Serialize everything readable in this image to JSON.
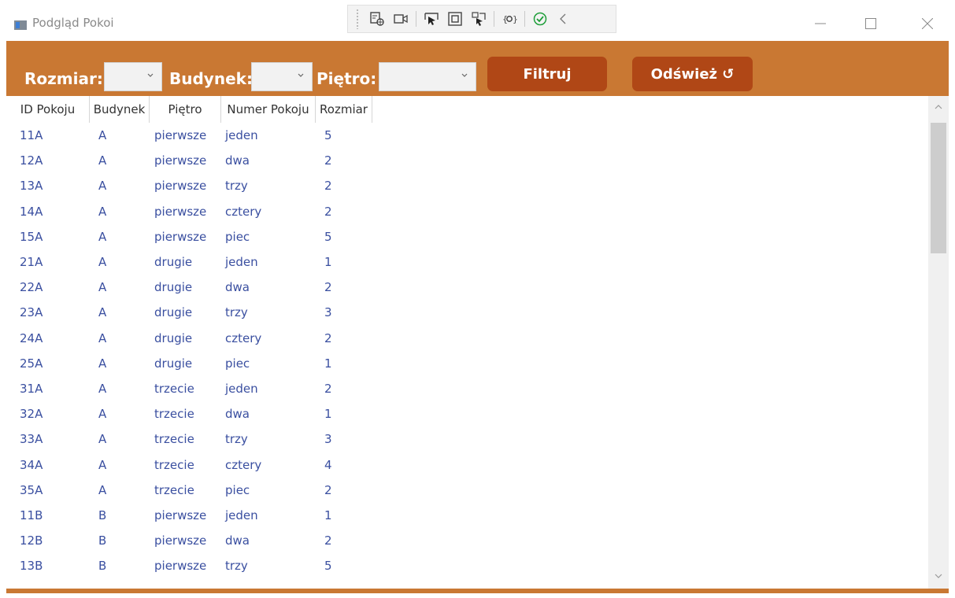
{
  "window": {
    "title": "Podgląd Pokoi",
    "controls": [
      "minimize",
      "maximize",
      "close"
    ]
  },
  "debug_toolbar": {
    "icons": [
      "live-visual-tree-icon",
      "record-icon",
      "select-element-icon",
      "display-layout-adorners-icon",
      "track-focused-element-icon",
      "binding-failures-icon",
      "hot-reload-ok-icon",
      "collapse-toolbar-icon"
    ]
  },
  "filters": {
    "rozmiar_label": "Rozmiar:",
    "rozmiar_value": "",
    "budynek_label": "Budynek:",
    "budynek_value": "",
    "pietro_label": "Piętro:",
    "pietro_value": "",
    "filter_button": "Filtruj",
    "refresh_button": "Odśwież ↺"
  },
  "grid": {
    "columns": [
      "ID Pokoju",
      "Budynek",
      "Piętro",
      "Numer Pokoju",
      "Rozmiar"
    ],
    "rows": [
      [
        "11A",
        "A",
        "pierwsze",
        "jeden",
        "5"
      ],
      [
        "12A",
        "A",
        "pierwsze",
        "dwa",
        "2"
      ],
      [
        "13A",
        "A",
        "pierwsze",
        "trzy",
        "2"
      ],
      [
        "14A",
        "A",
        "pierwsze",
        "cztery",
        "2"
      ],
      [
        "15A",
        "A",
        "pierwsze",
        "piec",
        "5"
      ],
      [
        "21A",
        "A",
        "drugie",
        "jeden",
        "1"
      ],
      [
        "22A",
        "A",
        "drugie",
        "dwa",
        "2"
      ],
      [
        "23A",
        "A",
        "drugie",
        "trzy",
        "3"
      ],
      [
        "24A",
        "A",
        "drugie",
        "cztery",
        "2"
      ],
      [
        "25A",
        "A",
        "drugie",
        "piec",
        "1"
      ],
      [
        "31A",
        "A",
        "trzecie",
        "jeden",
        "2"
      ],
      [
        "32A",
        "A",
        "trzecie",
        "dwa",
        "1"
      ],
      [
        "33A",
        "A",
        "trzecie",
        "trzy",
        "3"
      ],
      [
        "34A",
        "A",
        "trzecie",
        "cztery",
        "4"
      ],
      [
        "35A",
        "A",
        "trzecie",
        "piec",
        "2"
      ],
      [
        "11B",
        "B",
        "pierwsze",
        "jeden",
        "1"
      ],
      [
        "12B",
        "B",
        "pierwsze",
        "dwa",
        "2"
      ],
      [
        "13B",
        "B",
        "pierwsze",
        "trzy",
        "5"
      ]
    ]
  },
  "colors": {
    "accent": "#c97833",
    "button": "#b04716",
    "cell_text": "#3a4fa0"
  }
}
